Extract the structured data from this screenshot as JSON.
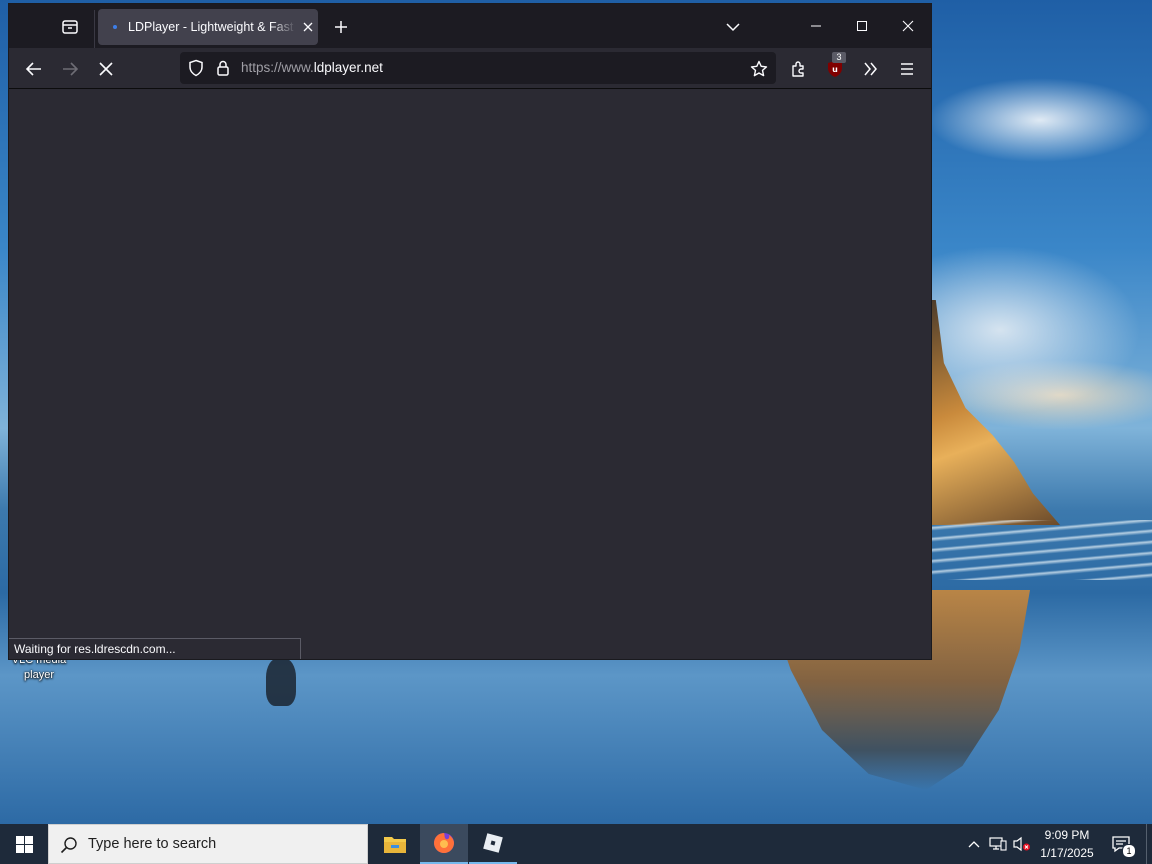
{
  "desktop": {
    "icons": [
      {
        "label": "VLC media player"
      }
    ]
  },
  "browser": {
    "tab_list_icon": "tab-list-icon",
    "tabs": [
      {
        "title": "LDPlayer - Lightweight & Fast Android Emulator for PC",
        "favicon": "ldplayer-favicon",
        "loading": true
      }
    ],
    "new_tab_icon": "plus-icon",
    "tab_overflow_icon": "chevron-down-icon",
    "window_controls": [
      "minimize-icon",
      "maximize-icon",
      "close-icon"
    ],
    "nav": {
      "back_icon": "arrow-left-icon",
      "forward_icon": "arrow-right-icon",
      "stop_icon": "stop-icon"
    },
    "url": {
      "scheme": "https://www.",
      "host": "ldplayer.net"
    },
    "toolbar": {
      "extensions_icon": "puzzle-icon",
      "ublock_badge": "3",
      "overflow_icon": "double-chevron-right-icon",
      "menu_icon": "hamburger-icon"
    },
    "status_text": "Waiting for res.ldrescdn.com..."
  },
  "taskbar": {
    "search_placeholder": "Type here to search",
    "pinned": [
      "file-explorer-icon",
      "firefox-icon",
      "roblox-icon"
    ],
    "clock_time": "9:09 PM",
    "clock_date": "1/17/2025",
    "notification_count": "1",
    "colors": {
      "accent": "#76b9ed",
      "taskbar": "#1e2a3a"
    }
  }
}
